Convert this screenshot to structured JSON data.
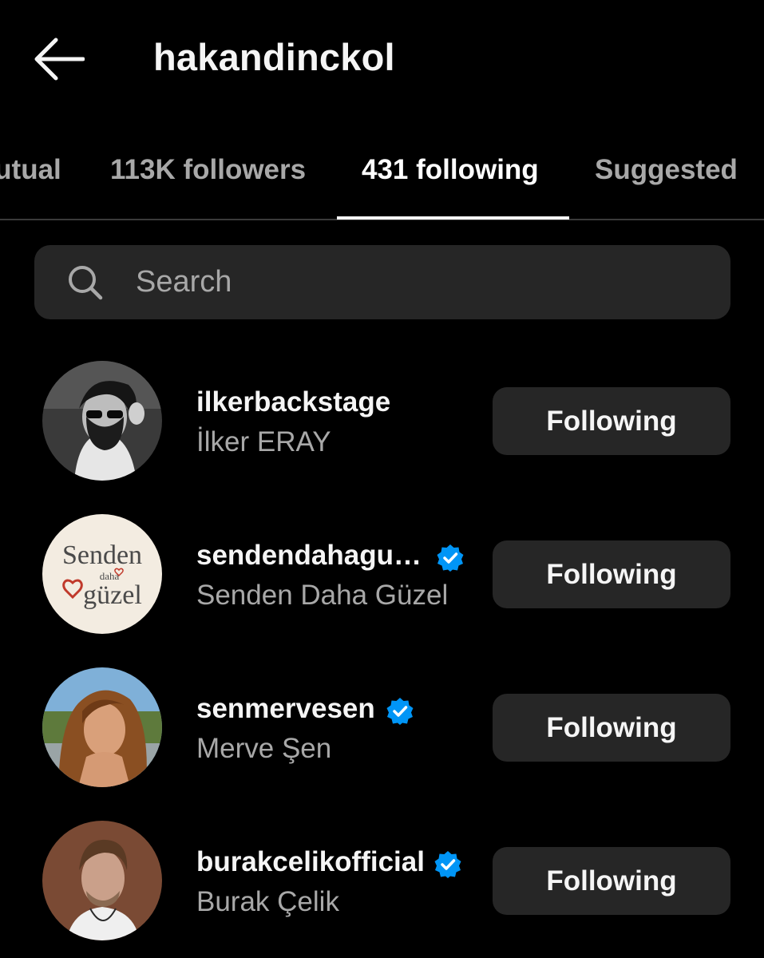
{
  "header": {
    "title": "hakandinckol"
  },
  "tabs": [
    {
      "label": "Mutual"
    },
    {
      "label": "113K followers"
    },
    {
      "label": "431 following"
    },
    {
      "label": "Suggested"
    }
  ],
  "search": {
    "placeholder": "Search"
  },
  "accounts": [
    {
      "username": "ilkerbackstage",
      "full_name": "İlker ERAY",
      "verified": false,
      "button": "Following"
    },
    {
      "username": "sendendahagu…",
      "full_name": "Senden Daha Güzel",
      "verified": true,
      "button": "Following",
      "avatar_text": [
        "Senden",
        "daha",
        "güzel"
      ]
    },
    {
      "username": "senmervesen",
      "full_name": "Merve Şen",
      "verified": true,
      "button": "Following"
    },
    {
      "username": "burakcelikofficial",
      "full_name": "Burak Çelik",
      "verified": true,
      "button": "Following"
    }
  ],
  "colors": {
    "background": "#000000",
    "surface": "#262626",
    "secondary_text": "#a8a8a8",
    "verified": "#0095f6"
  }
}
